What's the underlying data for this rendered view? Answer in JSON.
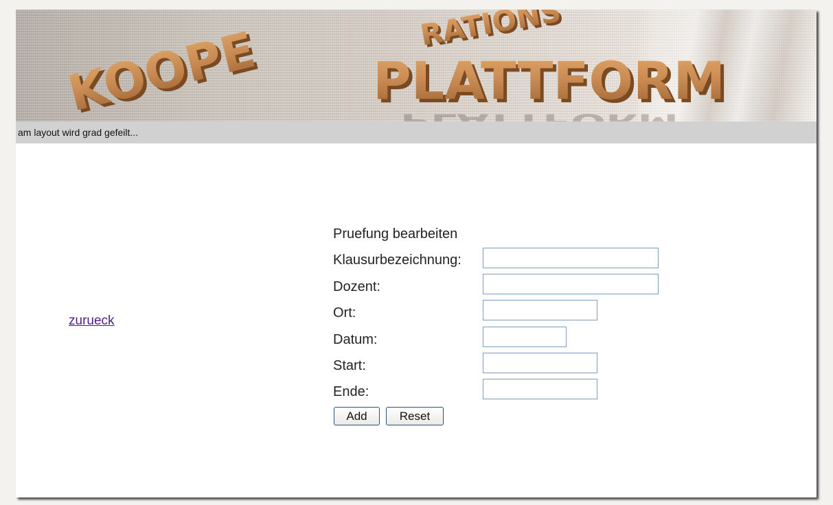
{
  "banner": {
    "logo_text_1": "KOOPE",
    "logo_text_2": "RATIONS",
    "logo_text_3": "PLATTFORM"
  },
  "status": {
    "message": "am layout wird grad gefeilt..."
  },
  "nav": {
    "back_label": "zurueck"
  },
  "form": {
    "title": "Pruefung bearbeiten",
    "fields": [
      {
        "label": "Klausurbezeichnung:",
        "value": ""
      },
      {
        "label": "Dozent:",
        "value": ""
      },
      {
        "label": "Ort:",
        "value": ""
      },
      {
        "label": "Datum:",
        "value": ""
      },
      {
        "label": "Start:",
        "value": ""
      },
      {
        "label": "Ende:",
        "value": ""
      }
    ],
    "add_label": "Add",
    "reset_label": "Reset"
  },
  "colors": {
    "link": "#551a8b",
    "status_bar": "#d1d1d1",
    "input_border": "#7f9db9",
    "button_border": "#2b4e8a",
    "logo_wood": "#c98d55"
  }
}
